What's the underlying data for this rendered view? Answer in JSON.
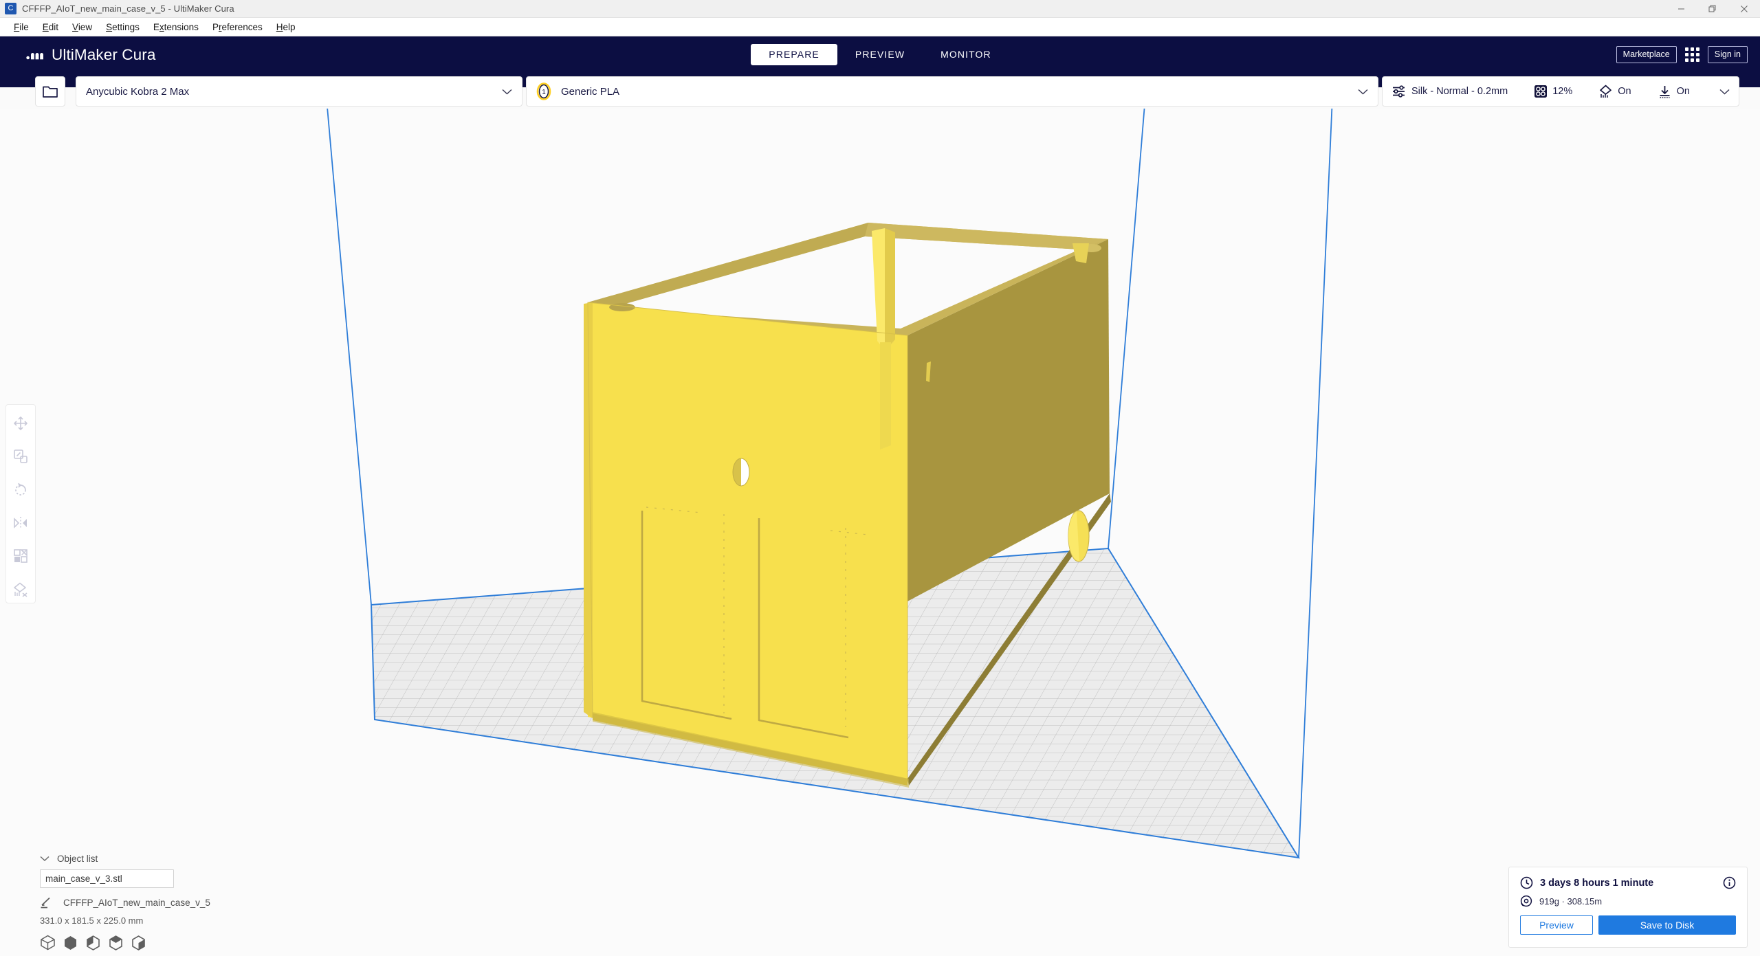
{
  "window": {
    "title": "CFFFP_AIoT_new_main_case_v_5 - UltiMaker Cura",
    "app_icon": "cura-app-icon",
    "controls": {
      "minimize": "minimize-icon",
      "restore": "restore-icon",
      "close": "close-icon"
    }
  },
  "menubar": {
    "items": [
      {
        "label": "File",
        "mnemonic": "F"
      },
      {
        "label": "Edit",
        "mnemonic": "E"
      },
      {
        "label": "View",
        "mnemonic": "V"
      },
      {
        "label": "Settings",
        "mnemonic": "S"
      },
      {
        "label": "Extensions",
        "mnemonic": "x"
      },
      {
        "label": "Preferences",
        "mnemonic": "r"
      },
      {
        "label": "Help",
        "mnemonic": "H"
      }
    ]
  },
  "header": {
    "brand": "UltiMaker Cura",
    "brand_icon": "ultimaker-logo-icon",
    "background": "#0c0e42",
    "tabs": [
      {
        "label": "PREPARE",
        "active": true
      },
      {
        "label": "PREVIEW",
        "active": false
      },
      {
        "label": "MONITOR",
        "active": false
      }
    ],
    "marketplace_label": "Marketplace",
    "signin_label": "Sign in",
    "apps_icon": "apps-grid-icon"
  },
  "settings_bar": {
    "open_file_icon": "folder-open-icon",
    "machine": {
      "name": "Anycubic Kobra 2 Max",
      "chevron": "chevron-down-icon"
    },
    "material": {
      "extruder_number": "1",
      "name": "Generic PLA",
      "chevron": "chevron-down-icon",
      "accent": "#ffd024"
    },
    "profile": {
      "quality_icon": "print-settings-sliders-icon",
      "quality": "Silk - Normal - 0.2mm",
      "infill_icon": "infill-icon",
      "infill": "12%",
      "support_icon": "support-icon",
      "support": "On",
      "adhesion_icon": "adhesion-icon",
      "adhesion": "On",
      "chevron": "chevron-down-icon"
    }
  },
  "toolbar": {
    "tools": [
      {
        "name": "move-tool",
        "icon": "move-icon"
      },
      {
        "name": "scale-tool",
        "icon": "scale-icon"
      },
      {
        "name": "rotate-tool",
        "icon": "rotate-icon"
      },
      {
        "name": "mirror-tool",
        "icon": "mirror-icon"
      },
      {
        "name": "per-model-settings-tool",
        "icon": "per-model-settings-icon"
      },
      {
        "name": "support-blocker-tool",
        "icon": "support-blocker-icon"
      }
    ]
  },
  "object_list": {
    "header": "Object list",
    "collapse_icon": "chevron-down-icon",
    "selected_object": "main_case_v_3.stl",
    "edit_icon": "pencil-icon",
    "project_name": "CFFFP_AIoT_new_main_case_v_5",
    "dimensions": "331.0 x 181.5 x 225.0 mm",
    "view_icons": [
      "cube-outline-icon",
      "cube-solid-icon",
      "cube-xray-icon",
      "cube-top-icon",
      "cube-layers-icon"
    ]
  },
  "job_panel": {
    "time_icon": "clock-icon",
    "print_time": "3 days 8 hours 1 minute",
    "info_icon": "info-icon",
    "material_icon": "spool-icon",
    "material_usage": "919g · 308.15m",
    "preview_label": "Preview",
    "save_label": "Save to Disk",
    "accent": "#1f7ae0"
  },
  "viewport": {
    "model_color": "#f7e04d",
    "model_shade_side": "#a8953f",
    "model_shade_top": "#c9b45a",
    "build_volume_line": "#2e7dd8",
    "build_plate_fill": "#ececec",
    "grid_line": "#b9b9b9",
    "background": "#fbfbfb"
  }
}
